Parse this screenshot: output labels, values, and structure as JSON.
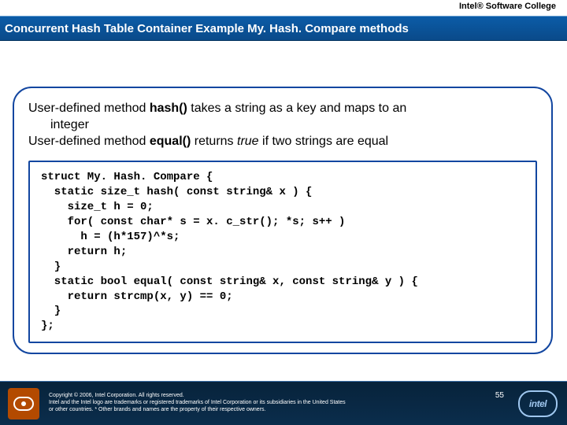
{
  "header": {
    "brand": "Intel® Software College"
  },
  "title": "Concurrent Hash Table Container Example My. Hash. Compare methods",
  "content": {
    "line1a": "User-defined method ",
    "line1b": "hash()",
    "line1c": " takes a string as a key and maps to an",
    "line2": "integer",
    "line3a": "User-defined method ",
    "line3b": "equal()",
    "line3c": " returns ",
    "line3d": "true",
    "line3e": " if two strings are equal"
  },
  "code": "struct My. Hash. Compare {\n  static size_t hash( const string& x ) {\n    size_t h = 0;\n    for( const char* s = x. c_str(); *s; s++ )\n      h = (h*157)^*s;\n    return h;\n  }\n  static bool equal( const string& x, const string& y ) {\n    return strcmp(x, y) == 0;\n  }\n};",
  "footer": {
    "copyright": "Copyright © 2006, Intel Corporation. All rights reserved.\nIntel and the Intel logo are trademarks or registered trademarks of Intel Corporation or its subsidiaries in the United States\nor other countries. * Other brands and names are the property of their respective owners.",
    "page": "55",
    "logo_text": "intel"
  }
}
